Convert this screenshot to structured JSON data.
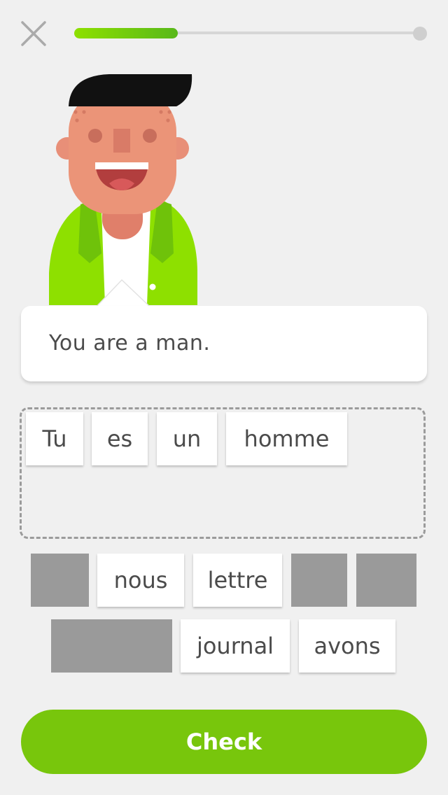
{
  "header": {
    "close_icon": "close-icon",
    "progress_fraction": 0.3
  },
  "prompt": {
    "text": "You are a man."
  },
  "answer": {
    "tiles": [
      "Tu",
      "es",
      "un",
      "homme"
    ]
  },
  "word_bank": {
    "tiles": [
      {
        "label": "",
        "used": true
      },
      {
        "label": "nous",
        "used": false
      },
      {
        "label": "lettre",
        "used": false
      },
      {
        "label": "",
        "used": true
      },
      {
        "label": "",
        "used": true
      },
      {
        "label": "",
        "used": true
      },
      {
        "label": "journal",
        "used": false
      },
      {
        "label": "avons",
        "used": false
      }
    ]
  },
  "check_button": {
    "label": "Check"
  },
  "colors": {
    "accent": "#78c60c",
    "progress_start": "#8ee000",
    "progress_end": "#58b81a",
    "used_tile": "#9a9a9a"
  }
}
